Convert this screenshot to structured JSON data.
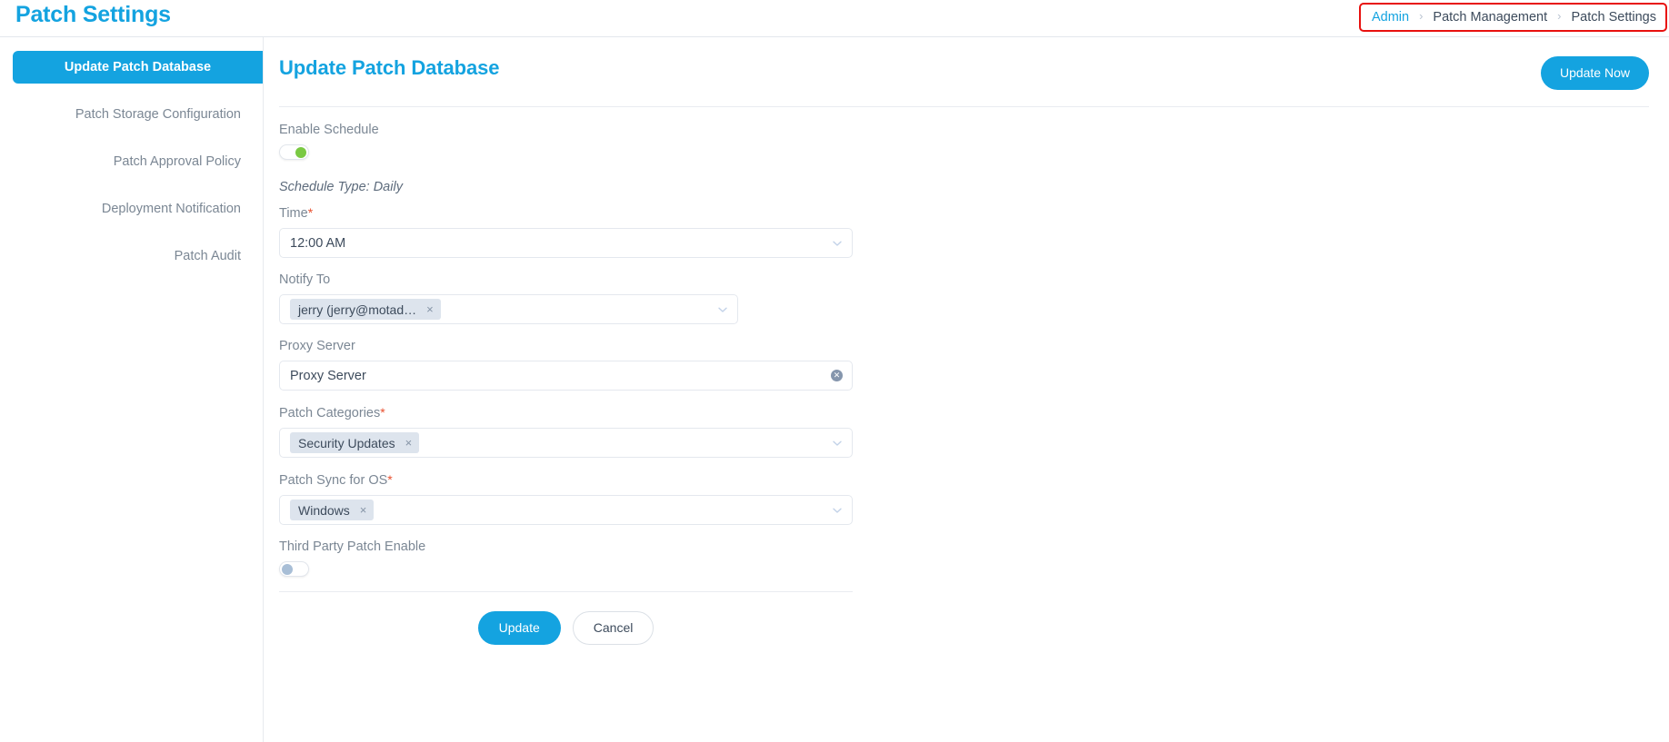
{
  "header": {
    "title": "Patch Settings",
    "breadcrumb": [
      {
        "label": "Admin",
        "is_link": true
      },
      {
        "label": "Patch Management",
        "is_link": false
      },
      {
        "label": "Patch Settings",
        "is_link": false
      }
    ],
    "separator": "›",
    "highlight_color": "#e8110f"
  },
  "sidebar": {
    "items": [
      {
        "label": "Update Patch Database",
        "active": true
      },
      {
        "label": "Patch Storage Configuration",
        "active": false
      },
      {
        "label": "Patch Approval Policy",
        "active": false
      },
      {
        "label": "Deployment Notification",
        "active": false
      },
      {
        "label": "Patch Audit",
        "active": false
      }
    ]
  },
  "content": {
    "title": "Update Patch Database",
    "update_now_label": "Update Now",
    "accent_color": "#14a3e0",
    "enable_schedule": {
      "label": "Enable Schedule",
      "state": "on"
    },
    "schedule_type": "Schedule Type: Daily",
    "time": {
      "label": "Time",
      "required": true,
      "value": "12:00 AM",
      "icon": "chevron-down-icon"
    },
    "notify_to": {
      "label": "Notify To",
      "required": false,
      "chips": [
        "jerry (jerry@motad…"
      ],
      "icon": "chevron-down-icon"
    },
    "proxy_server": {
      "label": "Proxy Server",
      "required": false,
      "value": "Proxy Server",
      "icon": "clear-circle-icon"
    },
    "patch_categories": {
      "label": "Patch Categories",
      "required": true,
      "chips": [
        "Security Updates"
      ],
      "icon": "chevron-down-icon"
    },
    "patch_sync_for_os": {
      "label": "Patch Sync for OS",
      "required": true,
      "chips": [
        "Windows"
      ],
      "icon": "chevron-down-icon"
    },
    "third_party": {
      "label": "Third Party Patch Enable",
      "state": "off"
    },
    "footer": {
      "update_label": "Update",
      "cancel_label": "Cancel"
    },
    "chip_remove_glyph": "×",
    "required_glyph": "*"
  }
}
